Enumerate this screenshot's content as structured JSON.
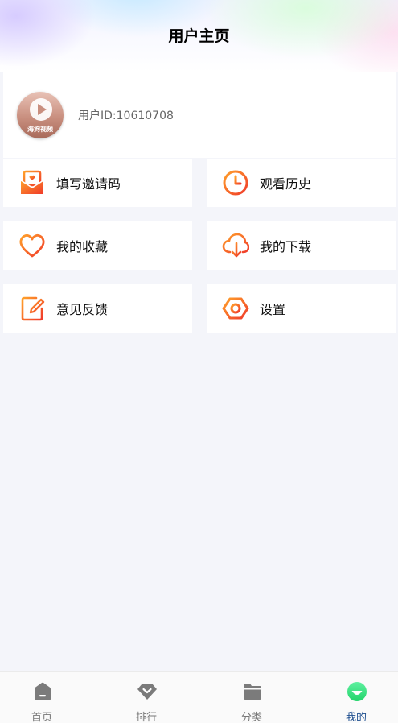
{
  "header": {
    "title": "用户主页"
  },
  "profile": {
    "avatar_text": "海狗视频",
    "user_id": "用户ID:10610708"
  },
  "menu": [
    {
      "label": "填写邀请码",
      "icon": "invite-envelope-icon"
    },
    {
      "label": "观看历史",
      "icon": "clock-icon"
    },
    {
      "label": "我的收藏",
      "icon": "heart-icon"
    },
    {
      "label": "我的下载",
      "icon": "cloud-download-icon"
    },
    {
      "label": "意见反馈",
      "icon": "feedback-edit-icon"
    },
    {
      "label": "设置",
      "icon": "hexagon-settings-icon"
    }
  ],
  "nav": [
    {
      "label": "首页",
      "icon": "home-icon",
      "active": false
    },
    {
      "label": "排行",
      "icon": "rank-icon",
      "active": false
    },
    {
      "label": "分类",
      "icon": "folder-icon",
      "active": false
    },
    {
      "label": "我的",
      "icon": "profile-face-icon",
      "active": true
    }
  ],
  "colors": {
    "icon_orange": "#ff7a1a",
    "icon_red": "#f03a2a",
    "nav_inactive": "#777777",
    "nav_active_label": "#1f4f8f",
    "nav_active_icon": "#2ee07a",
    "background": "#f4f5fa"
  }
}
